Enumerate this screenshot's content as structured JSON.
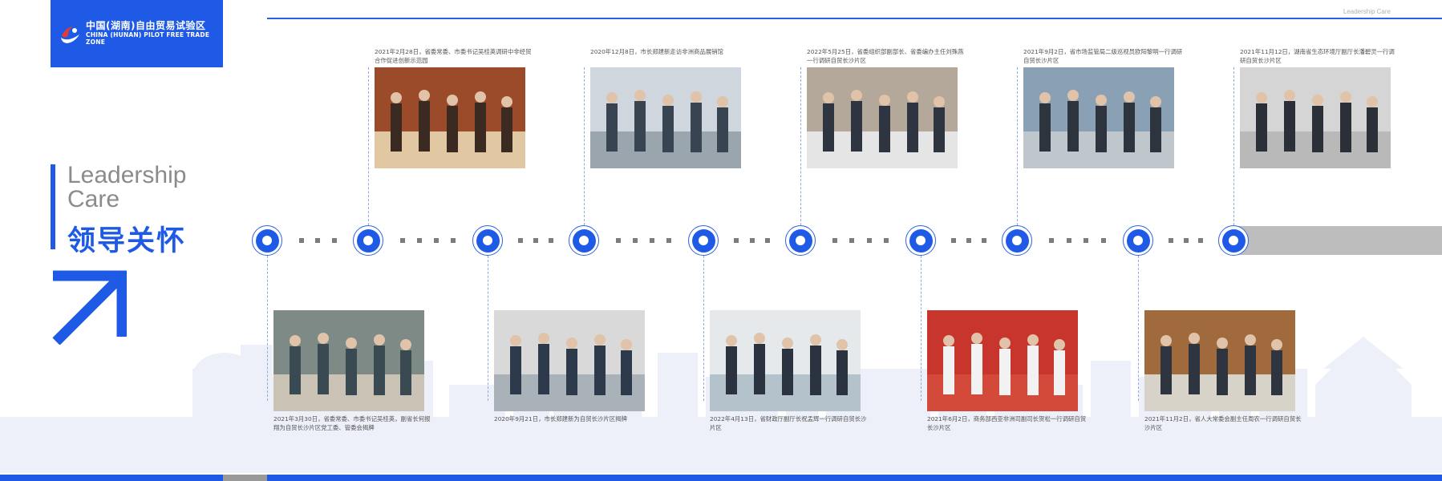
{
  "logo": {
    "cn": "中国(湖南)自由贸易试验区",
    "en": "CHINA (HUNAN) PILOT FREE TRADE ZONE"
  },
  "header": {
    "label": "Leadership Care"
  },
  "title": {
    "en_line1": "Leadership",
    "en_line2": "Care",
    "cn": "领导关怀"
  },
  "colors": {
    "accent": "#1f5ae6",
    "gray": "#bdbdbd"
  },
  "icons": [
    "logo-mark-icon",
    "arrow-up-right-icon"
  ],
  "events_top": [
    {
      "caption": "2021年2月28日，省委常委、市委书记吴桂英调研中非经贸合作促进创新示范园"
    },
    {
      "caption": "2020年12月8日，市长郑建新走访非洲商品展销馆"
    },
    {
      "caption": "2022年5月25日，省委组织部副部长、省委编办主任刘殊燕一行调研自贸长沙片区"
    },
    {
      "caption": "2021年9月2日，省市场监管局二级巡视员欧阳黎明一行调研自贸长沙片区"
    },
    {
      "caption": "2021年11月12日，湖南省生态环境厅副厅长潘碧灵一行调研自贸长沙片区"
    }
  ],
  "events_bottom": [
    {
      "caption": "2021年3月30日，省委常委、市委书记吴桂英，副省长何报翔为自贸长沙片区党工委、管委会揭牌"
    },
    {
      "caption": "2020年9月21日，市长郑建新为自贸长沙片区揭牌"
    },
    {
      "caption": "2022年4月13日，省财政厅副厅长祝孟辉一行调研自贸长沙片区"
    },
    {
      "caption": "2021年6月2日，商务部西亚非洲司副司长贺松一行调研自贸长沙片区"
    },
    {
      "caption": "2021年11月2日，省人大常委会副主任周农一行调研自贸长沙片区"
    }
  ]
}
